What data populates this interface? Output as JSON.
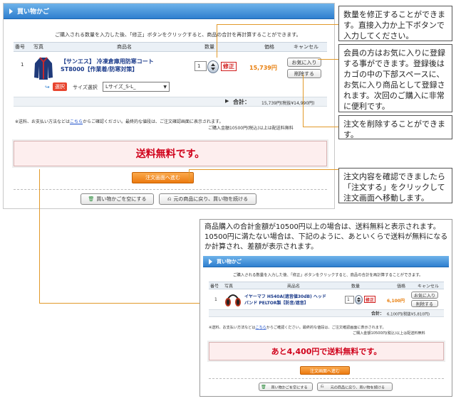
{
  "cart": {
    "title": "買い物かご",
    "instructions": "ご購入される数量を入力した後、「修正」ボタンをクリックすると、商品の合計を再計算することができます。",
    "columns": [
      "番号",
      "写真",
      "商品名",
      "数量",
      "価格",
      "キャンセル"
    ],
    "item": {
      "number": "1",
      "name_line1": "【サンエス】 冷凍倉庫用防寒コート",
      "name_line2": "ST8000【作業着/防寒対策】",
      "quantity": "1",
      "fix_label": "修正",
      "price": "15,739円",
      "favorite_label": "お気に入り",
      "delete_label": "削除する",
      "option_badge": "選択",
      "size_label": "サイズ選択",
      "size_value": "Lサイズ_S-L_"
    },
    "total_label": "合計：",
    "total_value": "15,739円(税抜¥14,990円)",
    "note_line1_a": "※送料、お支払い方法などは",
    "note_link": "こちら",
    "note_line1_b": "からご確認ください。最終的な値段は、ご注文確認画面に表示されます。",
    "note_line2": "ご購入金額10500円(税込)以上は配送料無料",
    "free_shipping": "送料無料です。",
    "order_button": "注文画面へ進む",
    "empty_cart_button": "買い物かごを空にする",
    "continue_button": "元の商品に戻り、買い物を続ける"
  },
  "notes": {
    "quantity": "数量を修正することができます。直接入力か上下ボタンで入力してください。",
    "favorite": "会員の方はお気に入りに登録する事ができます。登録後はカゴの中の下部スペースに、お気に入り商品として登録されます。次回のご購入に非常に便利です。",
    "delete": "注文を削除することができます。",
    "order": "注文内容を確認できましたら「注文する」をクリックして注文画面へ移動します。",
    "shipping": "商品購入の合計金額が10500円以上の場合は、送料無料と表示されます。10500円に満たない場合は、下記のように、あといくらで送料が無料になるか計算され、差額が表示されます。"
  },
  "example": {
    "title": "買い物かご",
    "instructions": "ご購入される数量を入力した後、「修正」ボタンをクリックすると、商品の合計を再計算することができます。",
    "columns": [
      "番号",
      "写真",
      "商品名",
      "数量",
      "価格",
      "キャンセル"
    ],
    "item": {
      "number": "1",
      "name_line1": "イヤーマフ H540A(遮音値30dB) ヘッド",
      "name_line2": "バンド PELTOR製【防音/遮音】",
      "quantity": "1",
      "fix_label": "修正",
      "price": "6,100円",
      "favorite_label": "お気に入り",
      "delete_label": "削除する"
    },
    "total_label": "合計：",
    "total_value": "6,100円(税抜¥5,810円)",
    "note_line1_a": "※送料、お支払い方法などは",
    "note_link": "こちら",
    "note_line1_b": "からご確認ください。最終的な値段は、ご注文確認画面に表示されます。",
    "note_line2": "ご購入金額10500円(税込)以上は配送料無料",
    "free_shipping": "あと4,400円で送料無料です。",
    "order_button": "注文画面へ進む",
    "empty_cart_button": "買い物かごを空にする",
    "continue_button": "元の商品に戻り、買い物を続ける"
  },
  "colors": {
    "accent": "#2f7fcf",
    "price": "#e87d0a",
    "alert": "#d0021b",
    "leader": "#e29a2a"
  }
}
